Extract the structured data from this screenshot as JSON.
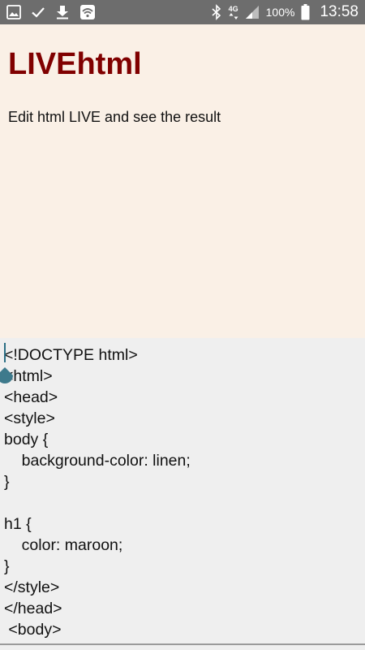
{
  "status_bar": {
    "left_icons": [
      "gallery-icon",
      "check-icon",
      "download-icon",
      "wifi-icon"
    ],
    "network_label": "4G",
    "battery_percent": "100%",
    "time": "13:58"
  },
  "preview": {
    "heading": "LIVEhtml",
    "paragraph": "Edit html LIVE and see the result",
    "background_color": "#faf0e6",
    "heading_color": "#800000"
  },
  "editor": {
    "lines": [
      "<!DOCTYPE html>",
      "<html>",
      "<head>",
      "<style>",
      "body {",
      "    background-color: linen;",
      "}",
      "",
      "h1 {",
      "    color: maroon;",
      "}",
      "</style>",
      "</head>",
      " <body>"
    ],
    "cursor_color": "#2b6f85"
  }
}
